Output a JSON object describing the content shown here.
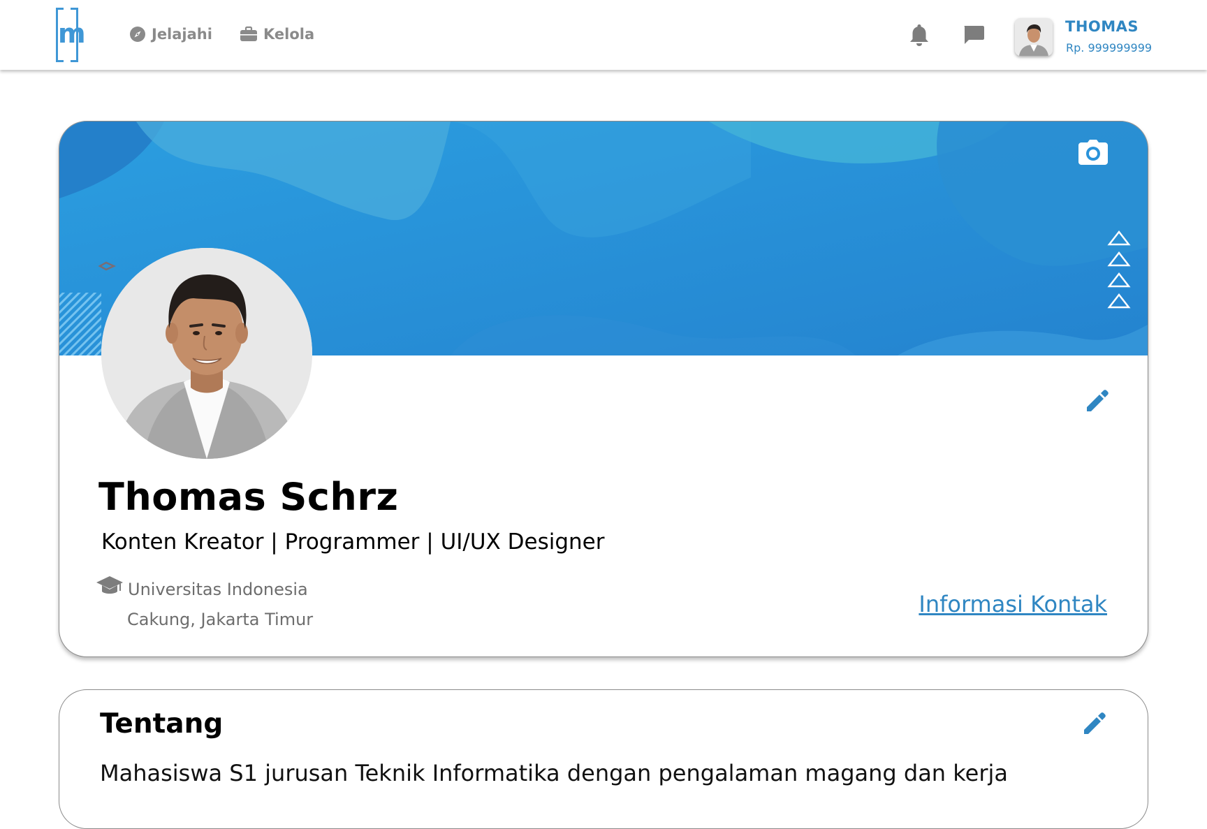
{
  "header": {
    "logo": "m",
    "nav": [
      {
        "label": "Jelajahi",
        "icon": "compass-icon"
      },
      {
        "label": "Kelola",
        "icon": "briefcase-icon"
      }
    ],
    "icons": [
      "bell-icon",
      "chat-icon"
    ],
    "user": {
      "name": "THOMAS",
      "balance": "Rp. 999999999"
    }
  },
  "profile": {
    "name": "Thomas Schrz",
    "headline": "Konten Kreator | Programmer | UI/UX Designer",
    "education": "Universitas Indonesia",
    "location": "Cakung, Jakarta Timur",
    "contact_link": "Informasi Kontak"
  },
  "about": {
    "title": "Tentang",
    "text": "Mahasiswa S1 jurusan Teknik Informatika dengan pengalaman magang dan kerja"
  },
  "colors": {
    "brand_blue": "#2f86c2",
    "banner_blue": "#2a93da",
    "icon_gray": "#7d7d7d"
  }
}
